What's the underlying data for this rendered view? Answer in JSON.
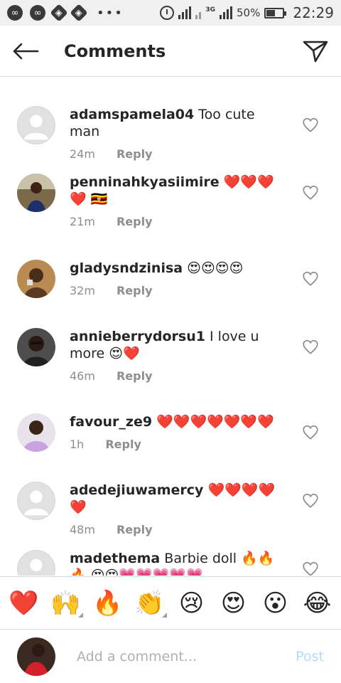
{
  "status_bar": {
    "battery": "50%",
    "time": "22:29",
    "network": "3G"
  },
  "header": {
    "title": "Comments",
    "back_icon": "back-arrow-icon",
    "send_icon": "paper-plane-icon"
  },
  "comments": [
    {
      "username": "adamspamela04",
      "text": "Too cute man",
      "emoji": "",
      "time": "24m",
      "reply": "Reply",
      "avatar": "default"
    },
    {
      "username": "penninahkyasiimire",
      "text": "",
      "emoji": "❤️❤️❤️❤️ 🇺🇬",
      "time": "21m",
      "reply": "Reply",
      "avatar": "photo"
    },
    {
      "username": "gladysndzinisa",
      "text": "",
      "emoji": "😍😍😍😍",
      "time": "32m",
      "reply": "Reply",
      "avatar": "photo"
    },
    {
      "username": "annieberrydorsu1",
      "text": "I love u more",
      "emoji": "😍❤️",
      "time": "46m",
      "reply": "Reply",
      "avatar": "photo"
    },
    {
      "username": "favour_ze9",
      "text": "",
      "emoji": "❤️❤️❤️❤️❤️❤️❤️",
      "time": "1h",
      "reply": "Reply",
      "avatar": "photo"
    },
    {
      "username": "adedejiuwamercy",
      "text": "",
      "emoji": "❤️❤️❤️❤️❤️",
      "time": "48m",
      "reply": "Reply",
      "avatar": "default"
    },
    {
      "username": "madethema",
      "text": "Barbie doll",
      "emoji": "🔥🔥🔥 😍😍💗💗💗💗💗",
      "time": "",
      "reply": "",
      "avatar": "default"
    }
  ],
  "emoji_bar": [
    "❤️",
    "🙌",
    "🔥",
    "👏",
    "😢",
    "😍",
    "😮",
    "😂"
  ],
  "composer": {
    "placeholder": "Add a comment...",
    "post_label": "Post"
  },
  "colors": {
    "text": "#262626",
    "meta": "#8e8e8e",
    "divider": "#dbdbdb",
    "post_disabled": "#b3dbff"
  }
}
